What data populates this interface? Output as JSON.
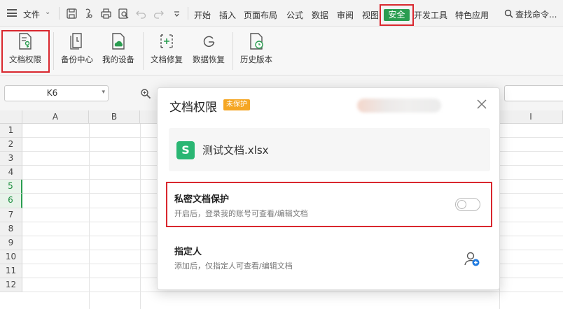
{
  "menubar": {
    "file_label": "文件",
    "tabs": [
      "开始",
      "插入",
      "页面布局",
      "公式",
      "数据",
      "审阅",
      "视图"
    ],
    "active_tab": "安全",
    "tabs_after": [
      "开发工具",
      "特色应用"
    ],
    "search_label": "查找命令...",
    "quick_access_icons": [
      "save-icon",
      "brush-icon",
      "print-icon",
      "print-preview-icon",
      "undo-icon",
      "redo-icon",
      "customize-icon"
    ]
  },
  "ribbon": {
    "buttons": [
      {
        "label": "文档权限",
        "icon": "document-permission-icon"
      },
      {
        "label": "备份中心",
        "icon": "backup-center-icon"
      },
      {
        "label": "我的设备",
        "icon": "my-device-icon"
      },
      {
        "label": "文档修复",
        "icon": "document-repair-icon"
      },
      {
        "label": "数据恢复",
        "icon": "data-recovery-icon"
      },
      {
        "label": "历史版本",
        "icon": "history-version-icon"
      }
    ]
  },
  "formula_bar": {
    "cell_ref": "K6"
  },
  "grid": {
    "columns": [
      "A",
      "B",
      "I"
    ],
    "rows": [
      "1",
      "2",
      "3",
      "4",
      "5",
      "6",
      "7",
      "8",
      "9",
      "10",
      "11",
      "12"
    ],
    "selected_rows": [
      "5",
      "6"
    ]
  },
  "dialog": {
    "title": "文档权限",
    "status_badge": "未保护",
    "file_name": "测试文档.xlsx",
    "file_icon_letter": "S",
    "private_protection": {
      "title": "私密文档保护",
      "description": "开启后，登录我的账号可查看/编辑文档",
      "enabled": false
    },
    "designated_person": {
      "title": "指定人",
      "description": "添加后，仅指定人可查看/编辑文档"
    }
  },
  "colors": {
    "accent_green": "#2a9d50",
    "highlight_red": "#d9272e",
    "badge_orange": "#f5a623",
    "file_icon_green": "#2ab673",
    "add_user_blue": "#1f7ae0"
  }
}
